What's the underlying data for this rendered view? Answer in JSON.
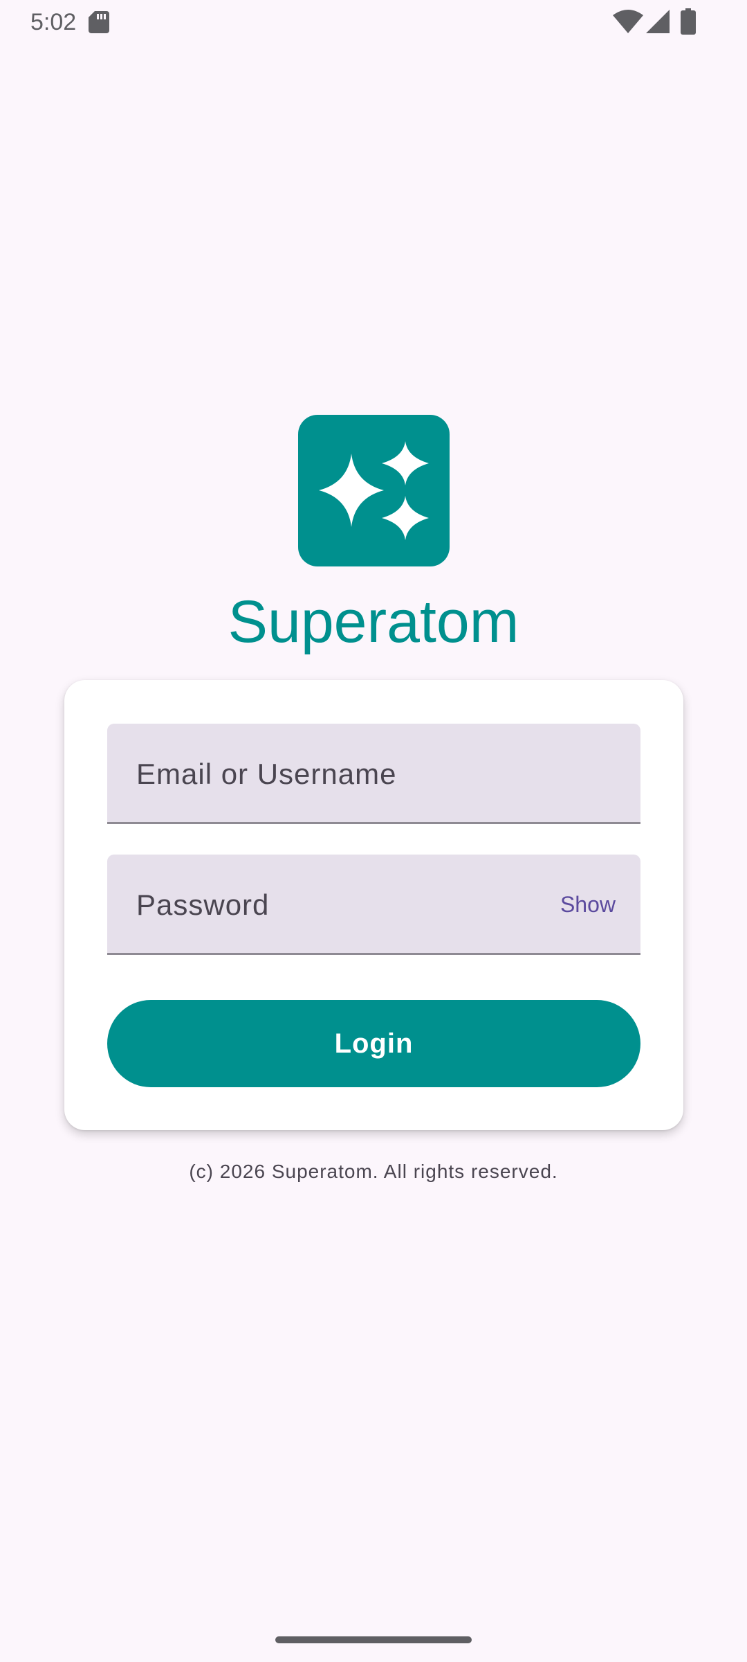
{
  "status_bar": {
    "time": "5:02",
    "icons": [
      "sd-card-icon",
      "wifi-icon",
      "signal-icon",
      "battery-icon"
    ]
  },
  "app": {
    "name": "Superatom",
    "logo_icon": "sparkles-icon",
    "brand_color": "#00908E"
  },
  "login_form": {
    "email_placeholder": "Email or Username",
    "password_placeholder": "Password",
    "show_label": "Show",
    "login_label": "Login"
  },
  "footer": {
    "copyright": "(c) 2026 Superatom. All rights reserved."
  }
}
